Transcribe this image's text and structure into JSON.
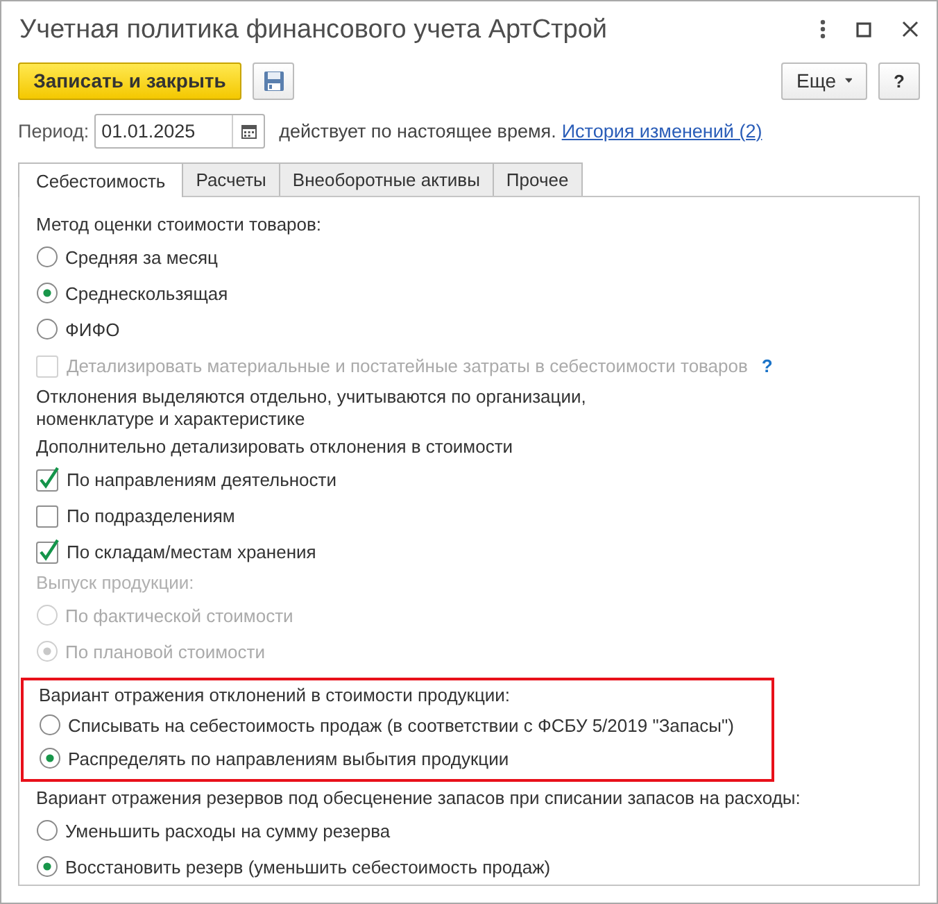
{
  "window": {
    "title": "Учетная политика финансового учета АртСтрой"
  },
  "toolbar": {
    "primary_button": "Записать и закрыть",
    "more_button": "Еще",
    "help_button": "?"
  },
  "period": {
    "label": "Период:",
    "value": "01.01.2025",
    "note": "действует по настоящее время.",
    "history_link": "История изменений (2)"
  },
  "tabs": [
    {
      "label": "Себестоимость",
      "selected": true
    },
    {
      "label": "Расчеты",
      "selected": false
    },
    {
      "label": "Внеоборотные активы",
      "selected": false
    },
    {
      "label": "Прочее",
      "selected": false
    }
  ],
  "content": [
    {
      "kind": "label",
      "text": "Метод оценки стоимости товаров:",
      "disabled": false
    },
    {
      "kind": "radio",
      "label": "Средняя за месяц",
      "selected": false,
      "disabled": false
    },
    {
      "kind": "radio",
      "label": "Среднескользящая",
      "selected": true,
      "disabled": false
    },
    {
      "kind": "radio",
      "label": "ФИФО",
      "selected": false,
      "disabled": false
    },
    {
      "kind": "checkbox",
      "label": "Детализировать материальные и постатейные затраты в себестоимости товаров",
      "checked": false,
      "disabled": true,
      "help": "?"
    },
    {
      "kind": "label",
      "text": "Отклонения выделяются отдельно, учитываются по организации,\nноменклатуре и характеристике",
      "disabled": false
    },
    {
      "kind": "label",
      "text": "Дополнительно детализировать отклонения в стоимости",
      "disabled": false
    },
    {
      "kind": "checkbox",
      "label": "По направлениям деятельности",
      "checked": true,
      "disabled": false
    },
    {
      "kind": "checkbox",
      "label": "По подразделениям",
      "checked": false,
      "disabled": false
    },
    {
      "kind": "checkbox",
      "label": "По складам/местам хранения",
      "checked": true,
      "disabled": false
    },
    {
      "kind": "label",
      "text": "Выпуск продукции:",
      "disabled": true
    },
    {
      "kind": "radio",
      "label": "По фактической стоимости",
      "selected": false,
      "disabled": true
    },
    {
      "kind": "radio",
      "label": "По плановой стоимости",
      "selected": true,
      "disabled": true
    },
    {
      "kind": "group",
      "highlighted": true,
      "items": [
        {
          "kind": "label",
          "text": "Вариант отражения отклонений в стоимости продукции:",
          "disabled": false
        },
        {
          "kind": "radio",
          "label": "Списывать на себестоимость продаж (в соответствии с ФСБУ 5/2019 \"Запасы\")",
          "selected": false,
          "disabled": false
        },
        {
          "kind": "radio",
          "label": "Распределять по направлениям выбытия продукции",
          "selected": true,
          "disabled": false
        }
      ]
    },
    {
      "kind": "label",
      "text": "Вариант отражения резервов под обесценение запасов при списании запасов на расходы:",
      "disabled": false
    },
    {
      "kind": "radio",
      "label": "Уменьшить расходы на сумму резерва",
      "selected": false,
      "disabled": false
    },
    {
      "kind": "radio",
      "label": "Восстановить резерв (уменьшить себестоимость продаж)",
      "selected": true,
      "disabled": false
    }
  ]
}
